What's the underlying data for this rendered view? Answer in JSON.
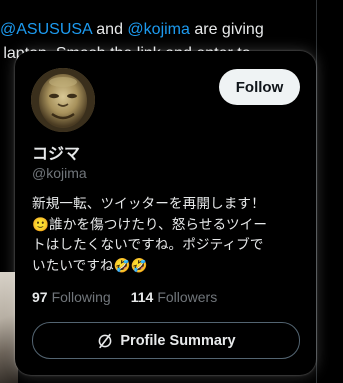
{
  "background_tweet": {
    "line1_prefix": "@ASUSUSA",
    "line1_and": " and ",
    "line1_mention": "@kojima",
    "line1_suffix": " are giving",
    "line2": "g laptop. Smash the link and enter to"
  },
  "hover_card": {
    "display_name": "コジマ",
    "handle": "@kojima",
    "follow_label": "Follow",
    "bio_lines": [
      "新規一転、ツイッターを再開します！",
      "🙂誰かを傷つけたり、怒らせるツイー",
      "トはしたくないですね。ポジティブで",
      "いたいですね🤣🤣"
    ],
    "following_count": "97",
    "following_label": "Following",
    "followers_count": "114",
    "followers_label": "Followers",
    "profile_summary_label": "Profile Summary"
  },
  "icons": {
    "avatar": "profile-photo",
    "profile_summary": "grok-icon"
  },
  "colors": {
    "background": "#000000",
    "mention": "#1d9bf0",
    "follow_button_bg": "#eff3f4",
    "muted_text": "#71767b",
    "primary_text": "#e7e9ea"
  }
}
